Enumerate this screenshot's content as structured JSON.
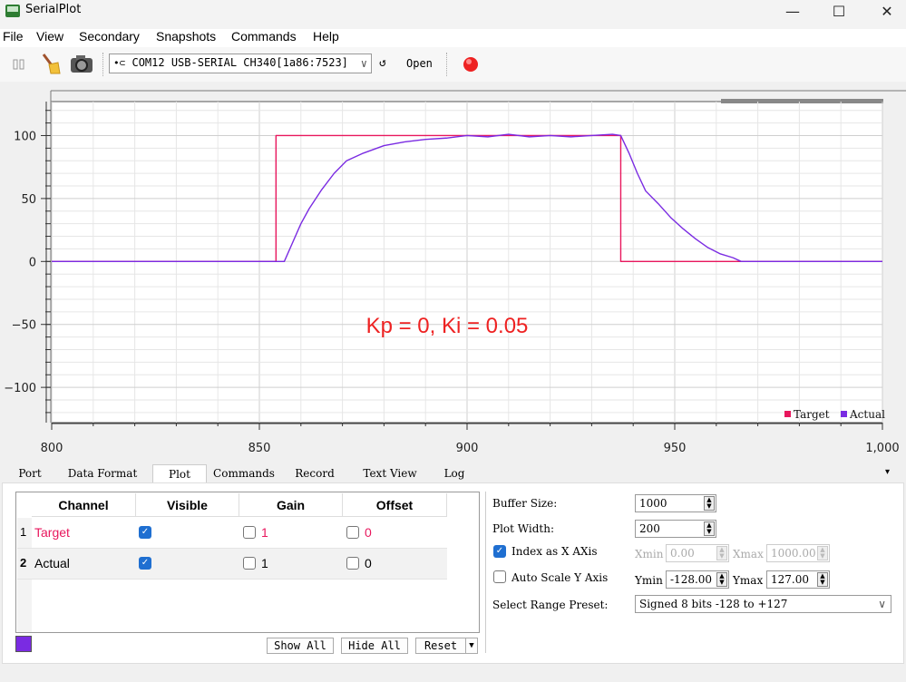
{
  "window": {
    "title": "SerialPlot",
    "minimize": "—",
    "maximize": "☐",
    "close": "✕"
  },
  "menu": [
    {
      "label": "File"
    },
    {
      "label": "View"
    },
    {
      "label": "Secondary"
    },
    {
      "label": "Snapshots"
    },
    {
      "label": "Commands"
    },
    {
      "label": "Help"
    }
  ],
  "toolbar": {
    "port": "COM12 USB-SERIAL CH340[1a86:7523]",
    "refresh_icon": "↺",
    "open_label": "Open",
    "icons": [
      "pause-icon",
      "broom-icon",
      "camera-icon",
      "usb-icon",
      "record-icon"
    ]
  },
  "plot": {
    "annotation": "Kp = 0, Ki = 0.05",
    "legend": [
      "Target",
      "Actual"
    ],
    "colors": {
      "target": "#e8175d",
      "actual": "#7a2be2"
    }
  },
  "chart_data": {
    "type": "line",
    "x_ticks": [
      "800",
      "850",
      "900",
      "950",
      "1,000"
    ],
    "y_ticks": [
      "100",
      "50",
      "0",
      "−50",
      "−100"
    ],
    "xlim": [
      800,
      1000
    ],
    "ylim": [
      -128,
      127
    ],
    "grid": true,
    "legend_position": "bottom-right",
    "series": [
      {
        "name": "Target",
        "x": [
          800,
          854,
          854,
          937,
          937,
          1000
        ],
        "y": [
          0,
          0,
          100,
          100,
          0,
          0
        ]
      },
      {
        "name": "Actual",
        "x": [
          800,
          856,
          858,
          860,
          862,
          865,
          868,
          871,
          875,
          880,
          885,
          890,
          895,
          900,
          905,
          910,
          915,
          920,
          925,
          930,
          935,
          937,
          939,
          941,
          943,
          946,
          949,
          952,
          955,
          958,
          961,
          964,
          966,
          970,
          1000
        ],
        "y": [
          0,
          0,
          15,
          30,
          42,
          57,
          70,
          80,
          86,
          92,
          95,
          97,
          98,
          100,
          99,
          101,
          99,
          100,
          99,
          100,
          101,
          100,
          86,
          70,
          56,
          46,
          35,
          26,
          18,
          11,
          6,
          3,
          0,
          0,
          0
        ]
      }
    ]
  },
  "tabs": [
    {
      "label": "Port"
    },
    {
      "label": "Data Format"
    },
    {
      "label": "Plot"
    },
    {
      "label": "Commands"
    },
    {
      "label": "Record"
    },
    {
      "label": "Text View"
    },
    {
      "label": "Log"
    }
  ],
  "tab_arrow": "▾",
  "channel_table": {
    "headers": [
      "Channel",
      "Visible",
      "Gain",
      "Offset"
    ],
    "rows": [
      {
        "index": "1",
        "name": "Target",
        "gain": "1",
        "offset": "0",
        "color": "#e8175d"
      },
      {
        "index": "2",
        "name": "Actual",
        "gain": "1",
        "offset": "0",
        "color": "#000000"
      }
    ],
    "swatch_color": "#7a2be2",
    "show_all": "Show All",
    "hide_all": "Hide All",
    "reset": "Reset",
    "reset_arrow": "▼"
  },
  "settings": {
    "buffer_size_label": "Buffer Size:",
    "buffer_size": "1000",
    "plot_width_label": "Plot Width:",
    "plot_width": "200",
    "index_x_label": "Index as X AXis",
    "xmin_label": "Xmin",
    "xmin": "0.00",
    "xmax_label": "Xmax",
    "xmax": "1000.00",
    "auto_scale_label": "Auto Scale Y Axis",
    "ymin_label": "Ymin",
    "ymin": "-128.00",
    "ymax_label": "Ymax",
    "ymax": "127.00",
    "range_preset_label": "Select Range Preset:",
    "range_preset": "Signed 8 bits -128 to +127"
  }
}
